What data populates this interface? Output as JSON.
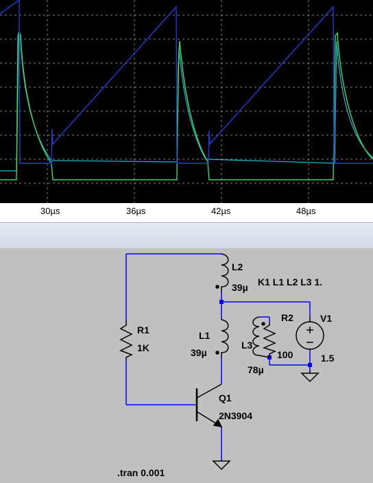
{
  "waveform": {
    "axis": {
      "x_unit": "µs",
      "x_ticks": [
        "30µs",
        "36µs",
        "42µs",
        "48µs"
      ]
    },
    "colors": {
      "background": "#000000",
      "grid": "#7f7f7f",
      "trace_blue": "#1a3fd6",
      "trace_green": "#33dd66",
      "trace_cyan": "#22b8d8"
    }
  },
  "schematic": {
    "components": {
      "l2": {
        "name": "L2",
        "value": "39µ"
      },
      "l1": {
        "name": "L1",
        "value": "39µ"
      },
      "l3": {
        "name": "L3",
        "value": "78µ"
      },
      "r1": {
        "name": "R1",
        "value": "1K"
      },
      "r2": {
        "name": "R2",
        "value": "100"
      },
      "v1": {
        "name": "V1",
        "value": "1.5"
      },
      "q1": {
        "name": "Q1",
        "value": "2N3904"
      }
    },
    "coupling_directive": "K1 L1 L2 L3 1.",
    "sim_directive": ".tran 0.001",
    "colors": {
      "wire": "#0000ff",
      "junction": "#0000ff"
    }
  }
}
